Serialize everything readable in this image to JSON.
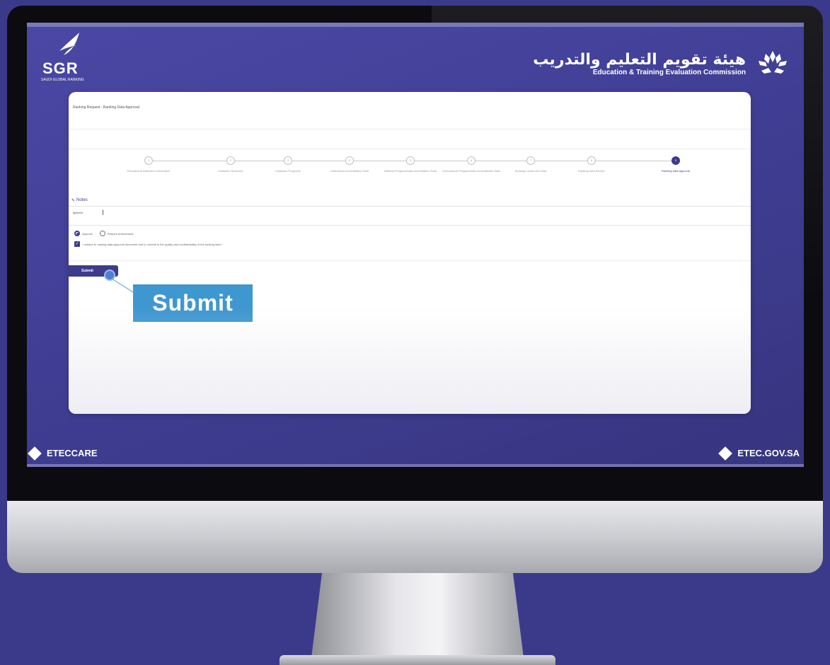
{
  "screen": {
    "logo_left": {
      "text": "SGR",
      "subtitle": "SAUDI GLOBAL RANKING"
    },
    "brand_right": {
      "arabic_name": "هيئة تقويم التعليم والتدريب",
      "english_name": "Education & Training Evaluation Commission"
    },
    "footer": {
      "left_label": "ETECCARE",
      "right_label": "ETEC.GOV.SA"
    }
  },
  "page": {
    "breadcrumb": "Ranking Request - Ranking Data Approval",
    "steps": [
      {
        "number": "1",
        "label": "Educational Institution Information"
      },
      {
        "number": "2",
        "label": "Institution Branches"
      },
      {
        "number": "3",
        "label": "Institution Programs"
      },
      {
        "number": "4",
        "label": "Institutional Accreditation Data"
      },
      {
        "number": "5",
        "label": "National Programmatic Accreditation Data"
      },
      {
        "number": "6",
        "label": "International Programmatic Accreditation Data"
      },
      {
        "number": "7",
        "label": "Ranking Levels and Data"
      },
      {
        "number": "8",
        "label": "Ranking data Review"
      },
      {
        "number": "9",
        "label": "Ranking data approval",
        "active": true
      }
    ],
    "notes": {
      "label": "Notes",
      "value": "approve"
    },
    "options": {
      "approve_label": "Approve",
      "amend_label": "Require Amendment",
      "declaration": "I adhere to ranking data approval document and to commit to the quality and confidentiality of the ranking data *"
    },
    "submit_button": "Submit",
    "callout_label": "Submit"
  },
  "colors": {
    "primary": "#3c3b8c",
    "callout": "#3f97d0",
    "background": "#3b3a8a"
  }
}
